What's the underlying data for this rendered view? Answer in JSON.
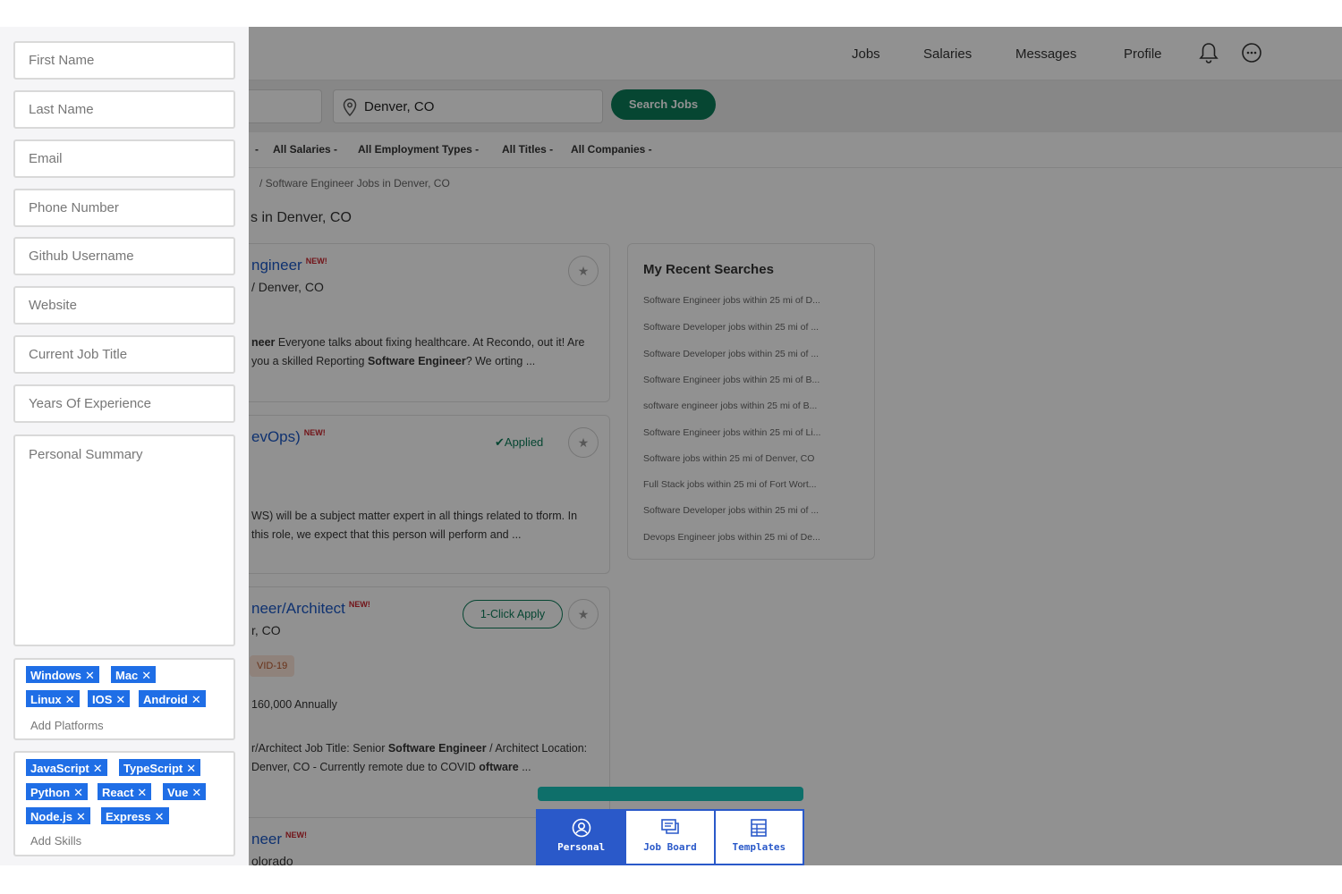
{
  "nav": {
    "items": [
      "Jobs",
      "Salaries",
      "Messages",
      "Profile"
    ]
  },
  "search": {
    "location": "Denver, CO",
    "button": "Search Jobs"
  },
  "filters": [
    "-",
    "All Salaries -",
    "All Employment Types -",
    "All Titles -",
    "All Companies -"
  ],
  "breadcrumb": "/  Software Engineer Jobs in Denver, CO",
  "results_heading": "s in Denver, CO",
  "jobs": [
    {
      "title": "ngineer",
      "badge": "NEW!",
      "location": "/ Denver, CO",
      "desc_b1": "neer",
      "desc_t1": " Everyone talks about fixing healthcare. At Recondo, out it! Are you a skilled Reporting ",
      "desc_b2": "Software Engineer",
      "desc_t2": "? We orting ..."
    },
    {
      "title": "evOps)",
      "badge": "NEW!",
      "status": "Applied",
      "desc_t1": "WS) will be a subject matter expert in all things related to tform. In this role, we expect that this person will perform and ..."
    },
    {
      "title": "neer/Architect",
      "badge": "NEW!",
      "location": "r, CO",
      "apply_label": "1-Click Apply",
      "tag": "VID-19",
      "salary": "160,000 Annually",
      "desc_t1": "r/Architect Job Title: Senior ",
      "desc_b1": "Software Engineer",
      "desc_t2": " / Architect Location: Denver, CO - Currently remote due to COVID ",
      "desc_b2": "oftware",
      "desc_t3": " ..."
    },
    {
      "title": "neer",
      "badge": "NEW!",
      "location": "olorado"
    }
  ],
  "recent": {
    "title": "My Recent Searches",
    "items": [
      "Software Engineer jobs within 25 mi of D...",
      "Software Developer jobs within 25 mi of ...",
      "Software Developer jobs within 25 mi of ...",
      "Software Engineer jobs within 25 mi of B...",
      "software engineer jobs within 25 mi of B...",
      "Software Engineer jobs within 25 mi of Li...",
      "Software jobs within 25 mi of Denver, CO",
      "Full Stack jobs within 25 mi of Fort Wort...",
      "Software Developer jobs within 25 mi of ...",
      "Devops Engineer jobs within 25 mi of De..."
    ]
  },
  "tabs": [
    "Personal",
    "Job Board",
    "Templates"
  ],
  "form": {
    "first_name": "First Name",
    "last_name": "Last Name",
    "email": "Email",
    "phone": "Phone Number",
    "github": "Github Username",
    "website": "Website",
    "job_title": "Current Job Title",
    "experience": "Years Of Experience",
    "summary": "Personal Summary",
    "add_platforms": "Add Platforms",
    "add_skills": "Add Skills"
  },
  "platforms": [
    "Windows",
    "Mac",
    "Linux",
    "IOS",
    "Android"
  ],
  "skills": [
    "JavaScript",
    "TypeScript",
    "Python",
    "React",
    "Vue",
    "Node.js",
    "Express"
  ],
  "colors": {
    "accent_blue": "#1f6ee6",
    "tab_blue": "#2a59c9",
    "search_green": "#0b7b58",
    "progress_teal": "#0e6f6a",
    "link_blue": "#1c58c6",
    "new_red": "#c8242c"
  }
}
